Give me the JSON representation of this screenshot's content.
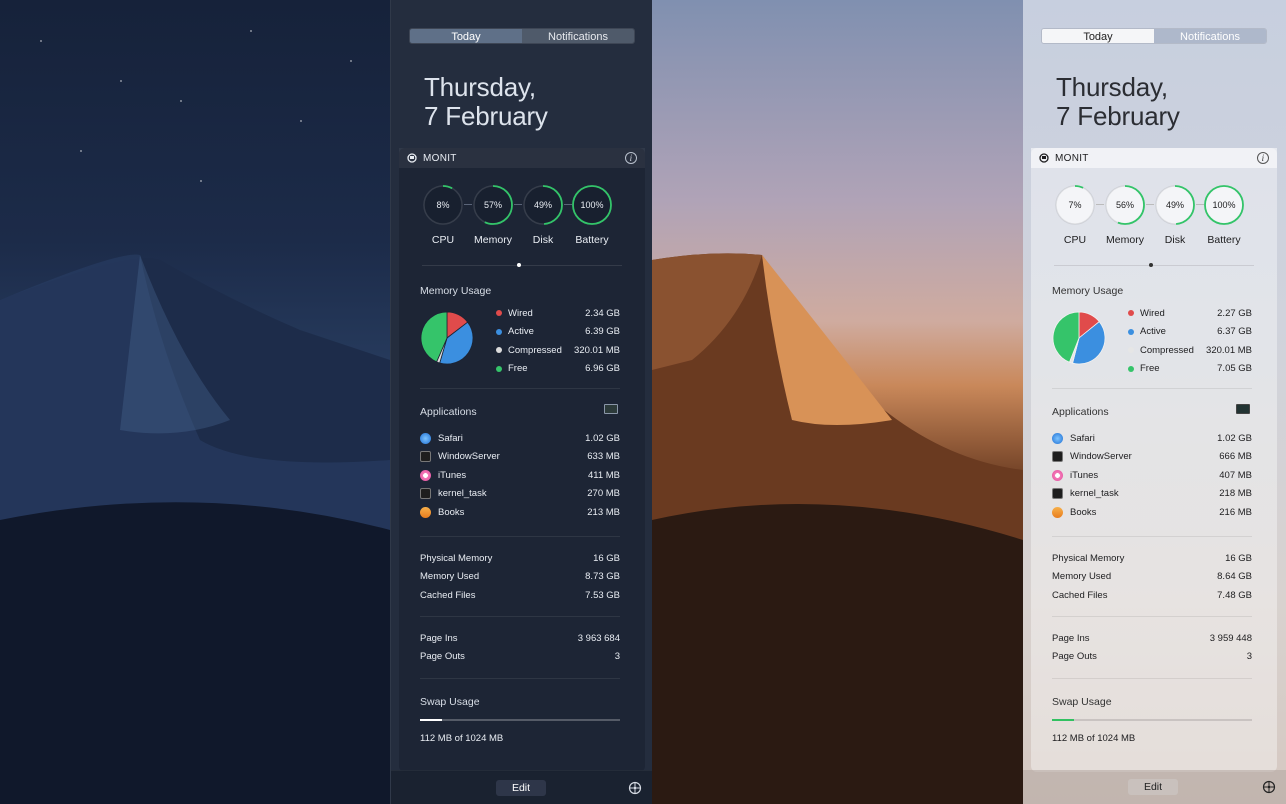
{
  "colors": {
    "wired": "#e04b4b",
    "active": "#3b8fe0",
    "compressed_dark": "#dcdcdc",
    "compressed_light": "#e6e6e6",
    "free": "#35c46a",
    "gauge_green": "#33c469"
  },
  "panels": [
    {
      "theme": "dark",
      "tabs": {
        "today": "Today",
        "notifications": "Notifications"
      },
      "date_line1": "Thursday,",
      "date_line2": "7 February",
      "widget_title": "MONIT",
      "gauges": [
        {
          "label": "CPU",
          "text": "8%",
          "value": 8
        },
        {
          "label": "Memory",
          "text": "57%",
          "value": 57
        },
        {
          "label": "Disk",
          "text": "49%",
          "value": 49
        },
        {
          "label": "Battery",
          "text": "100%",
          "value": 100
        }
      ],
      "memory_title": "Memory Usage",
      "memory": [
        {
          "name": "Wired",
          "value": "2.34 GB",
          "gb": 2.34,
          "icon": "wired-dot"
        },
        {
          "name": "Active",
          "value": "6.39 GB",
          "gb": 6.39,
          "icon": "active-dot"
        },
        {
          "name": "Compressed",
          "value": "320.01 MB",
          "gb": 0.32,
          "icon": "compressed-dot"
        },
        {
          "name": "Free",
          "value": "6.96 GB",
          "gb": 6.96,
          "icon": "free-dot"
        }
      ],
      "apps_title": "Applications",
      "apps": [
        {
          "name": "Safari",
          "value": "1.02 GB",
          "icon": "safari-icon"
        },
        {
          "name": "WindowServer",
          "value": "633 MB",
          "icon": "terminal-icon"
        },
        {
          "name": "iTunes",
          "value": "411 MB",
          "icon": "itunes-icon"
        },
        {
          "name": "kernel_task",
          "value": "270 MB",
          "icon": "terminal-icon"
        },
        {
          "name": "Books",
          "value": "213 MB",
          "icon": "books-icon"
        }
      ],
      "stats": [
        {
          "name": "Physical Memory",
          "value": "16 GB"
        },
        {
          "name": "Memory Used",
          "value": "8.73 GB"
        },
        {
          "name": "Cached Files",
          "value": "7.53 GB"
        }
      ],
      "pages": [
        {
          "name": "Page Ins",
          "value": "3 963 684"
        },
        {
          "name": "Page Outs",
          "value": "3"
        }
      ],
      "swap_title": "Swap Usage",
      "swap_text": "112 MB of 1024 MB",
      "swap_fraction": 0.109,
      "edit_label": "Edit"
    },
    {
      "theme": "light",
      "tabs": {
        "today": "Today",
        "notifications": "Notifications"
      },
      "date_line1": "Thursday,",
      "date_line2": "7 February",
      "widget_title": "MONIT",
      "gauges": [
        {
          "label": "CPU",
          "text": "7%",
          "value": 7
        },
        {
          "label": "Memory",
          "text": "56%",
          "value": 56
        },
        {
          "label": "Disk",
          "text": "49%",
          "value": 49
        },
        {
          "label": "Battery",
          "text": "100%",
          "value": 100
        }
      ],
      "memory_title": "Memory Usage",
      "memory": [
        {
          "name": "Wired",
          "value": "2.27 GB",
          "gb": 2.27,
          "icon": "wired-dot"
        },
        {
          "name": "Active",
          "value": "6.37 GB",
          "gb": 6.37,
          "icon": "active-dot"
        },
        {
          "name": "Compressed",
          "value": "320.01 MB",
          "gb": 0.32,
          "icon": "compressed-dot"
        },
        {
          "name": "Free",
          "value": "7.05 GB",
          "gb": 7.05,
          "icon": "free-dot"
        }
      ],
      "apps_title": "Applications",
      "apps": [
        {
          "name": "Safari",
          "value": "1.02 GB",
          "icon": "safari-icon"
        },
        {
          "name": "WindowServer",
          "value": "666 MB",
          "icon": "terminal-icon"
        },
        {
          "name": "iTunes",
          "value": "407 MB",
          "icon": "itunes-icon"
        },
        {
          "name": "kernel_task",
          "value": "218 MB",
          "icon": "terminal-icon"
        },
        {
          "name": "Books",
          "value": "216 MB",
          "icon": "books-icon"
        }
      ],
      "stats": [
        {
          "name": "Physical Memory",
          "value": "16 GB"
        },
        {
          "name": "Memory Used",
          "value": "8.64 GB"
        },
        {
          "name": "Cached Files",
          "value": "7.48 GB"
        }
      ],
      "pages": [
        {
          "name": "Page Ins",
          "value": "3 959 448"
        },
        {
          "name": "Page Outs",
          "value": "3"
        }
      ],
      "swap_title": "Swap Usage",
      "swap_text": "112 MB of 1024 MB",
      "swap_fraction": 0.109,
      "edit_label": "Edit"
    }
  ]
}
